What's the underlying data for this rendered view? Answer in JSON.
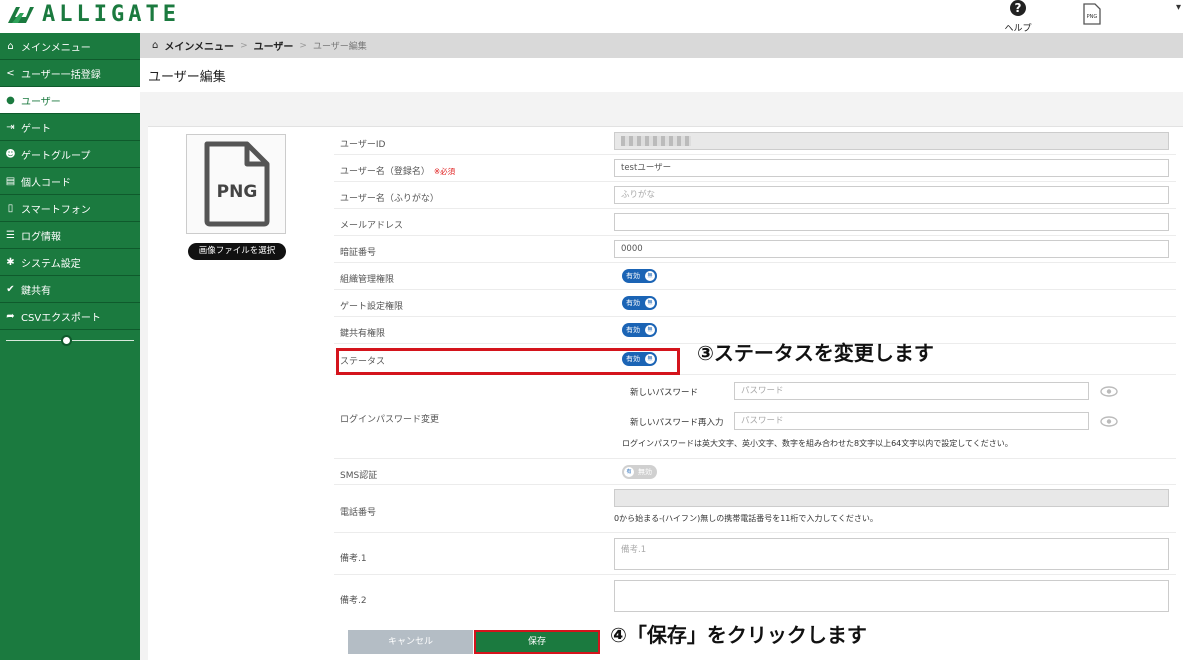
{
  "brand": {
    "logo_text": "ALLIGATE",
    "color": "#1b7a3f"
  },
  "topbar": {
    "help_label": "ヘルプ",
    "help_icon": "?",
    "png_icon_text": "PNG",
    "caret": "▾"
  },
  "sidebar": {
    "items": [
      {
        "label": "メインメニュー",
        "icon": "home-icon",
        "glyph": "⌂"
      },
      {
        "label": "ユーザー一括登録",
        "icon": "share-icon",
        "glyph": "<"
      },
      {
        "label": "ユーザー",
        "icon": "user-icon",
        "glyph": "●"
      },
      {
        "label": "ゲート",
        "icon": "signin-icon",
        "glyph": "⇥"
      },
      {
        "label": "ゲートグループ",
        "icon": "users-icon",
        "glyph": "☻"
      },
      {
        "label": "個人コード",
        "icon": "card-icon",
        "glyph": "▤"
      },
      {
        "label": "スマートフォン",
        "icon": "phone-icon",
        "glyph": "▯"
      },
      {
        "label": "ログ情報",
        "icon": "list-icon",
        "glyph": "☰"
      },
      {
        "label": "システム設定",
        "icon": "gear-icon",
        "glyph": "✱"
      },
      {
        "label": "鍵共有",
        "icon": "check-icon",
        "glyph": "✔"
      },
      {
        "label": "CSVエクスポート",
        "icon": "share-arrow-icon",
        "glyph": "➦"
      }
    ],
    "active_index": 2
  },
  "breadcrumb": {
    "home_icon": "⌂",
    "home": "メインメニュー",
    "sep": ">",
    "parent": "ユーザー",
    "current": "ユーザー編集"
  },
  "page": {
    "title": "ユーザー編集"
  },
  "image": {
    "placeholder_text": "PNG",
    "select_button": "画像ファイルを選択"
  },
  "form": {
    "user_id_label": "ユーザーID",
    "username_label": "ユーザー名（登録名）",
    "required_mark": "※必須",
    "username_value": "testユーザー",
    "kana_label": "ユーザー名（ふりがな）",
    "kana_placeholder": "ふりがな",
    "email_label": "メールアドレス",
    "email_value": "",
    "pin_label": "暗証番号",
    "pin_value": "0000",
    "org_admin_label": "組織管理権限",
    "gate_setting_label": "ゲート設定権限",
    "key_share_label": "鍵共有権限",
    "status_label": "ステータス",
    "toggle_on_text": "有効",
    "toggle_knob_text": "無",
    "toggle_off_text": "無効",
    "toggle_off_knob": "有",
    "login_pw_label": "ログインパスワード変更",
    "new_pw_label": "新しいパスワード",
    "new_pw_placeholder": "パスワード",
    "new_pw_confirm_label": "新しいパスワード再入力",
    "new_pw_confirm_placeholder": "パスワード",
    "pw_note": "ログインパスワードは英大文字、英小文字、数字を組み合わせた8文字以上64文字以内で設定してください。",
    "sms_label": "SMS認証",
    "phone_label": "電話番号",
    "phone_value": "",
    "phone_note": "0から始まる-(ハイフン)無しの携帯電話番号を11桁で入力してください。",
    "note1_label": "備考.1",
    "note1_placeholder": "備考.1",
    "note2_label": "備考.2",
    "note2_value": "",
    "cancel_label": "キャンセル",
    "save_label": "保存"
  },
  "annotations": {
    "step3": "③ステータスを変更します",
    "step4": "④「保存」をクリックします",
    "highlight_color": "#d4141c"
  }
}
